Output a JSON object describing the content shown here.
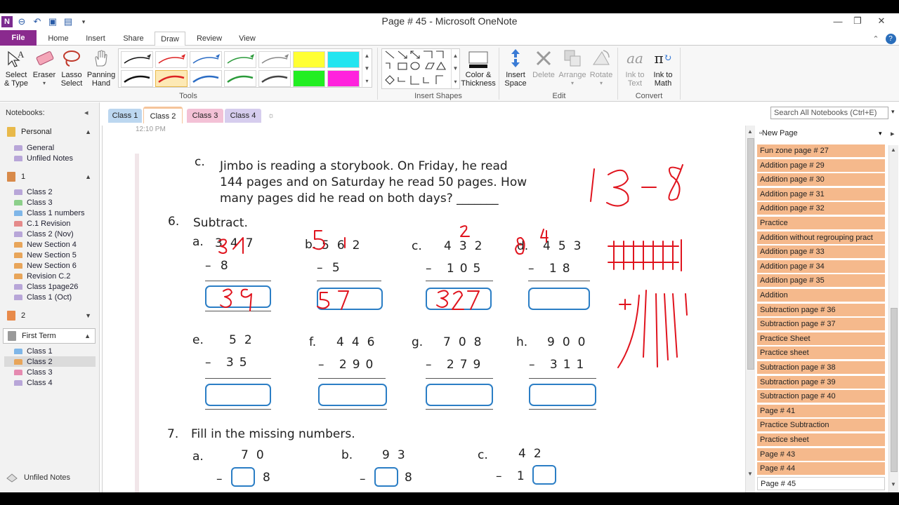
{
  "window": {
    "title": "Page # 45 - Microsoft OneNote",
    "minimize_glyph": "—",
    "restore_glyph": "❐",
    "close_glyph": "✕"
  },
  "ribbon_tabs": [
    "File",
    "Home",
    "Insert",
    "Share",
    "Draw",
    "Review",
    "View"
  ],
  "active_tab": "Draw",
  "ribbon": {
    "select_type": [
      "Select",
      "& Type"
    ],
    "eraser": "Eraser",
    "lasso": [
      "Lasso",
      "Select"
    ],
    "panning": [
      "Panning",
      "Hand"
    ],
    "tools_label": "Tools",
    "insert_shapes_label": "Insert Shapes",
    "color_thickness": [
      "Color &",
      "Thickness"
    ],
    "insert_space": [
      "Insert",
      "Space"
    ],
    "delete": "Delete",
    "arrange": "Arrange",
    "rotate": "Rotate",
    "edit_label": "Edit",
    "ink_to_text": [
      "Ink to",
      "Text"
    ],
    "ink_to_math": [
      "Ink to",
      "Math"
    ],
    "convert_label": "Convert"
  },
  "nav": {
    "header": "Notebooks:",
    "notebooks": [
      {
        "name": "Personal",
        "color": "#e8b94a",
        "sections": [
          {
            "name": "General",
            "color": "#b8a6d8"
          },
          {
            "name": "Unfiled Notes",
            "color": "#b8a6d8"
          }
        ]
      },
      {
        "name": "1",
        "color": "#d88a4a",
        "sections": [
          {
            "name": "Class 2",
            "color": "#b8a6d8"
          },
          {
            "name": "Class 3",
            "color": "#8ccf8a"
          },
          {
            "name": "Class 1 numbers",
            "color": "#7fb6e8"
          },
          {
            "name": "C.1 Revision",
            "color": "#e58a8a"
          },
          {
            "name": "Class 2 (Nov)",
            "color": "#b8a6d8"
          },
          {
            "name": "New Section 4",
            "color": "#e8a55a"
          },
          {
            "name": "New Section 5",
            "color": "#e8a55a"
          },
          {
            "name": "New Section 6",
            "color": "#e8a55a"
          },
          {
            "name": "Revision C.2",
            "color": "#e8a55a"
          },
          {
            "name": "Class 1page26",
            "color": "#b8a6d8"
          },
          {
            "name": "Class 1 (Oct)",
            "color": "#b8a6d8"
          }
        ]
      },
      {
        "name": "2",
        "color": "#e88a4a",
        "sections": []
      },
      {
        "name": "First Term",
        "color": "#9a9a9a",
        "sections": [
          {
            "name": "Class 1",
            "color": "#7fb6e8"
          },
          {
            "name": "Class 2",
            "color": "#e8a55a"
          },
          {
            "name": "Class 3",
            "color": "#e58ab0"
          },
          {
            "name": "Class 4",
            "color": "#b8a6d8"
          }
        ]
      }
    ],
    "unfiled": "Unfiled Notes"
  },
  "section_tabs": [
    {
      "name": "Class 1",
      "color": "#bcd7f0"
    },
    {
      "name": "Class 2",
      "color": "#f5c49a"
    },
    {
      "name": "Class 3",
      "color": "#f3c1d6"
    },
    {
      "name": "Class 4",
      "color": "#d6cdee"
    }
  ],
  "active_section": "Class 2",
  "search_placeholder": "Search All Notebooks (Ctrl+E)",
  "page": {
    "time": "12:10 PM",
    "q_c_label": "c.",
    "q_c_lines": [
      "Jimbo is reading a storybook. On Friday, he read",
      "144 pages and on Saturday he read 50 pages. How",
      "many pages did he read on both days? _______"
    ],
    "q6_num": "6.",
    "q6_title": "Subtract.",
    "subtract_problems": [
      {
        "label": "a.",
        "top": "347",
        "bottom": "–   8"
      },
      {
        "label": "b.",
        "top": "562",
        "bottom": "–   5"
      },
      {
        "label": "c.",
        "top": "432",
        "bottom": "– 105"
      },
      {
        "label": "d.",
        "top": "453",
        "bottom": "– 18"
      },
      {
        "label": "e.",
        "top": "52",
        "bottom": "– 35"
      },
      {
        "label": "f.",
        "top": "446",
        "bottom": "– 290"
      },
      {
        "label": "g.",
        "top": "708",
        "bottom": "– 279"
      },
      {
        "label": "h.",
        "top": "900",
        "bottom": "– 311"
      }
    ],
    "q7_num": "7.",
    "q7_title": "Fill in the missing numbers.",
    "fill_problems": [
      {
        "label": "a.",
        "top": "70",
        "bottom_op": "–",
        "bottom_digit": "8"
      },
      {
        "label": "b.",
        "top": "93",
        "bottom_op": "–",
        "bottom_digit": "8"
      },
      {
        "label": "c.",
        "top": "42",
        "bottom_op": "– 1",
        "bottom_digit": ""
      }
    ],
    "handwriting": {
      "margin_note": "13 - 8",
      "answers": [
        "39",
        "57",
        "327"
      ],
      "ink_color": "#e0141e"
    }
  },
  "pages_pane": {
    "new_page": "New Page",
    "pages": [
      "Fun zone page # 27",
      "Addition page # 29",
      "Addition page # 30",
      "Addition page # 31",
      "Addition page # 32",
      "Practice",
      "Addition without regrouping pract",
      "Addition page # 33",
      "Addition page # 34",
      "Addition page # 35",
      "Addition",
      "Subtraction page # 36",
      "Subtraction page # 37",
      "Practice Sheet",
      "Practice sheet",
      "Subtraction page # 38",
      "Subtraction page # 39",
      "Subtraction page # 40",
      "Page # 41",
      "Practice Subtraction",
      "Practice sheet",
      "Page # 43",
      "Page # 44",
      "Page # 45"
    ],
    "current": "Page # 45"
  }
}
